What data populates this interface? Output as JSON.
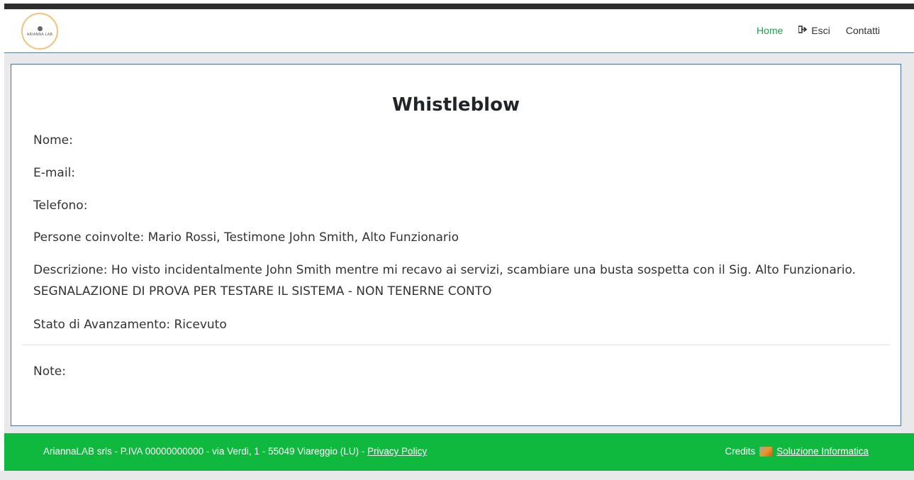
{
  "header": {
    "logo_text": "ARIANNA LAB",
    "nav": [
      {
        "label": "Home",
        "icon": "home",
        "active": true
      },
      {
        "label": "Esci",
        "icon": "sign-out-icon",
        "active": false
      },
      {
        "label": "Contatti",
        "icon": "",
        "active": false
      }
    ]
  },
  "main": {
    "title": "Whistleblow",
    "fields": {
      "nome": "Nome:",
      "email": "E-mail:",
      "telefono": "Telefono:",
      "persone": "Persone coinvolte: Mario Rossi, Testimone John Smith, Alto Funzionario",
      "descrizione": "Descrizione: Ho visto incidentalmente John Smith mentre mi recavo ai servizi, scambiare una busta sospetta con il Sig. Alto Funzionario. SEGNALAZIONE DI PROVA PER TESTARE IL SISTEMA - NON TENERNE CONTO",
      "stato": "Stato di Avanzamento: Ricevuto",
      "note": "Note:"
    }
  },
  "footer": {
    "company": "AriannaLAB srls - P.IVA 00000000000 - via Verdi, 1 - 55049 Viareggio (LU) -",
    "privacy_link": "Privacy Policy",
    "credits_label": "Credits",
    "credits_link": "Soluzione Informatica"
  },
  "colors": {
    "nav_active": "#1aa34a",
    "footer_bg": "#0fb93e",
    "card_border": "#4a6fa5"
  }
}
